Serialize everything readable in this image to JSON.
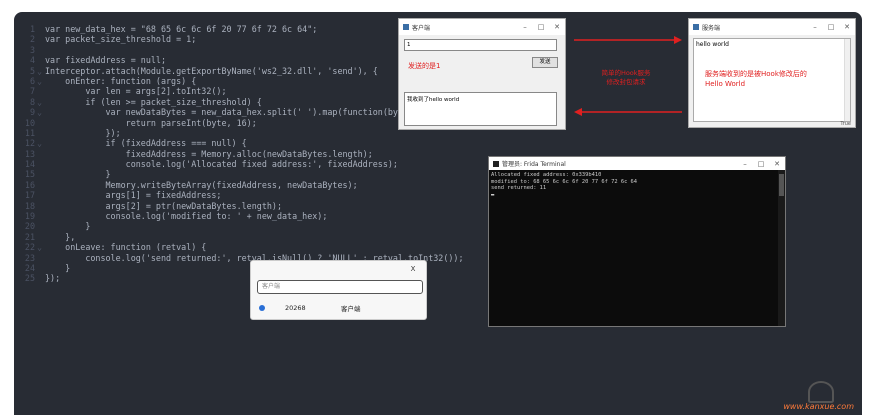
{
  "code": {
    "lines": [
      "var new_data_hex = \"68 65 6c 6c 6f 20 77 6f 72 6c 64\";",
      "var packet_size_threshold = 1;",
      "",
      "var fixedAddress = null;",
      "Interceptor.attach(Module.getExportByName('ws2_32.dll', 'send'), {",
      "    onEnter: function (args) {",
      "        var len = args[2].toInt32();",
      "        if (len >= packet_size_threshold) {",
      "            var newDataBytes = new_data_hex.split(' ').map(function(byte) {",
      "                return parseInt(byte, 16);",
      "            });",
      "            if (fixedAddress === null) {",
      "                fixedAddress = Memory.alloc(newDataBytes.length);",
      "                console.log('Allocated fixed address:', fixedAddress);",
      "            }",
      "            Memory.writeByteArray(fixedAddress, newDataBytes);",
      "            args[1] = fixedAddress;",
      "            args[2] = ptr(newDataBytes.length);",
      "            console.log('modified to: ' + new_data_hex);",
      "        }",
      "    },",
      "    onLeave: function (retval) {",
      "        console.log('send returned:', retval.isNull() ? 'NULL' : retval.toInt32());",
      "    }",
      "});"
    ],
    "line_numbers": [
      "1",
      "2",
      "3",
      "4",
      "5",
      "6",
      "7",
      "8",
      "9",
      "10",
      "11",
      "12",
      "13",
      "14",
      "15",
      "16",
      "17",
      "18",
      "19",
      "20",
      "21",
      "22",
      "23",
      "24",
      "25"
    ],
    "folds": [
      "",
      "",
      "",
      "",
      "⌄",
      "⌄",
      "",
      "⌄",
      "⌄",
      "",
      "",
      "⌄",
      "",
      "",
      "",
      "",
      "",
      "",
      "",
      "",
      "",
      "⌄",
      "",
      "",
      ""
    ]
  },
  "client_window": {
    "title": "客户端",
    "input_value": "1",
    "red_label": "发送的是1",
    "send_button": "发送",
    "received_text": "我收到了hello world"
  },
  "server_window": {
    "title": "服务端",
    "received_text": "hello world",
    "red_note_line1": "服务端收到的是被Hook修改后的",
    "red_note_line2": "Hello World",
    "footer": "True"
  },
  "annotation_center": {
    "line1": "简单的Hook服务",
    "line2": "修改封包请求"
  },
  "terminal": {
    "title": "管理员:  Frida Terminal",
    "lines": [
      "Allocated fixed address: 0x339b410",
      "modified to: 68 65 6c 6c 6f 20 77 6f 72 6c 64",
      "send returned: 11",
      "▬"
    ]
  },
  "dialog": {
    "close_label": "X",
    "search_placeholder": "客户端",
    "item_pid": "20268",
    "item_name": "客户端"
  },
  "watermark": "www.kanxue.com",
  "colors": {
    "editor_bg": "#282c34",
    "annotation_red": "#e02020",
    "watermark_orange": "#ff7b3a"
  }
}
